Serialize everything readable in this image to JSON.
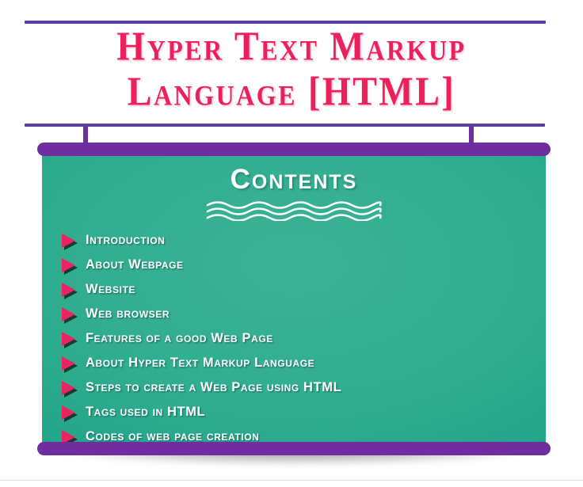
{
  "slide": {
    "title_lines": [
      "Hyper Text Markup",
      "Language [HTML]"
    ],
    "title_color": "#ec215c",
    "rule_color": "#5b3f9e"
  },
  "banner": {
    "heading": "Contents",
    "bar_color": "#6f2d9f",
    "panel_color": "#2fac8e",
    "bullet_color": "#e9245f",
    "text_color": "#ffffff",
    "wave_divider_name": "wavy-underline",
    "items": [
      {
        "label": "Introduction"
      },
      {
        "label": "About Webpage"
      },
      {
        "label": "Website"
      },
      {
        "label": "Web browser"
      },
      {
        "label": "Features of a good Web Page"
      },
      {
        "label": "About Hyper Text Markup Language"
      },
      {
        "label": "Steps to create a Web Page using HTML"
      },
      {
        "label": "Tags used in HTML"
      },
      {
        "label": "Codes of web page creation"
      }
    ]
  }
}
